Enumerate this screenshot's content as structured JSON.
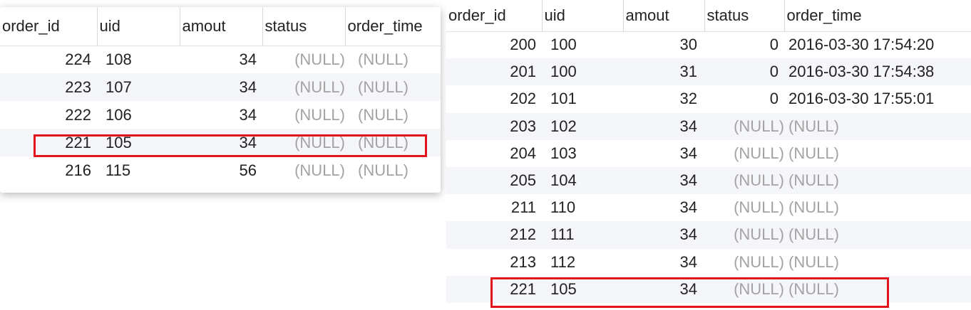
{
  "left_grid": {
    "columns": [
      "order_id",
      "uid",
      "amout",
      "status",
      "order_time"
    ],
    "rows": [
      [
        "224",
        "108",
        "34",
        "(NULL)",
        "(NULL)"
      ],
      [
        "223",
        "107",
        "34",
        "(NULL)",
        "(NULL)"
      ],
      [
        "222",
        "106",
        "34",
        "(NULL)",
        "(NULL)"
      ],
      [
        "221",
        "105",
        "34",
        "(NULL)",
        "(NULL)"
      ],
      [
        "216",
        "115",
        "56",
        "(NULL)",
        "(NULL)"
      ]
    ],
    "highlighted_row": 3
  },
  "right_grid": {
    "columns": [
      "order_id",
      "uid",
      "amout",
      "status",
      "order_time"
    ],
    "rows": [
      [
        "200",
        "100",
        "30",
        "0",
        "2016-03-30 17:54:20"
      ],
      [
        "201",
        "100",
        "31",
        "0",
        "2016-03-30 17:54:38"
      ],
      [
        "202",
        "101",
        "32",
        "0",
        "2016-03-30 17:55:01"
      ],
      [
        "203",
        "102",
        "34",
        "(NULL)",
        "(NULL)"
      ],
      [
        "204",
        "103",
        "34",
        "(NULL)",
        "(NULL)"
      ],
      [
        "205",
        "104",
        "34",
        "(NULL)",
        "(NULL)"
      ],
      [
        "211",
        "110",
        "34",
        "(NULL)",
        "(NULL)"
      ],
      [
        "212",
        "111",
        "34",
        "(NULL)",
        "(NULL)"
      ],
      [
        "213",
        "112",
        "34",
        "(NULL)",
        "(NULL)"
      ],
      [
        "221",
        "105",
        "34",
        "(NULL)",
        "(NULL)"
      ]
    ],
    "highlighted_row": 9
  },
  "colors": {
    "highlight": "#e3141b",
    "null_text": "#a3a3a3",
    "stripe": "#f4f6f9"
  }
}
